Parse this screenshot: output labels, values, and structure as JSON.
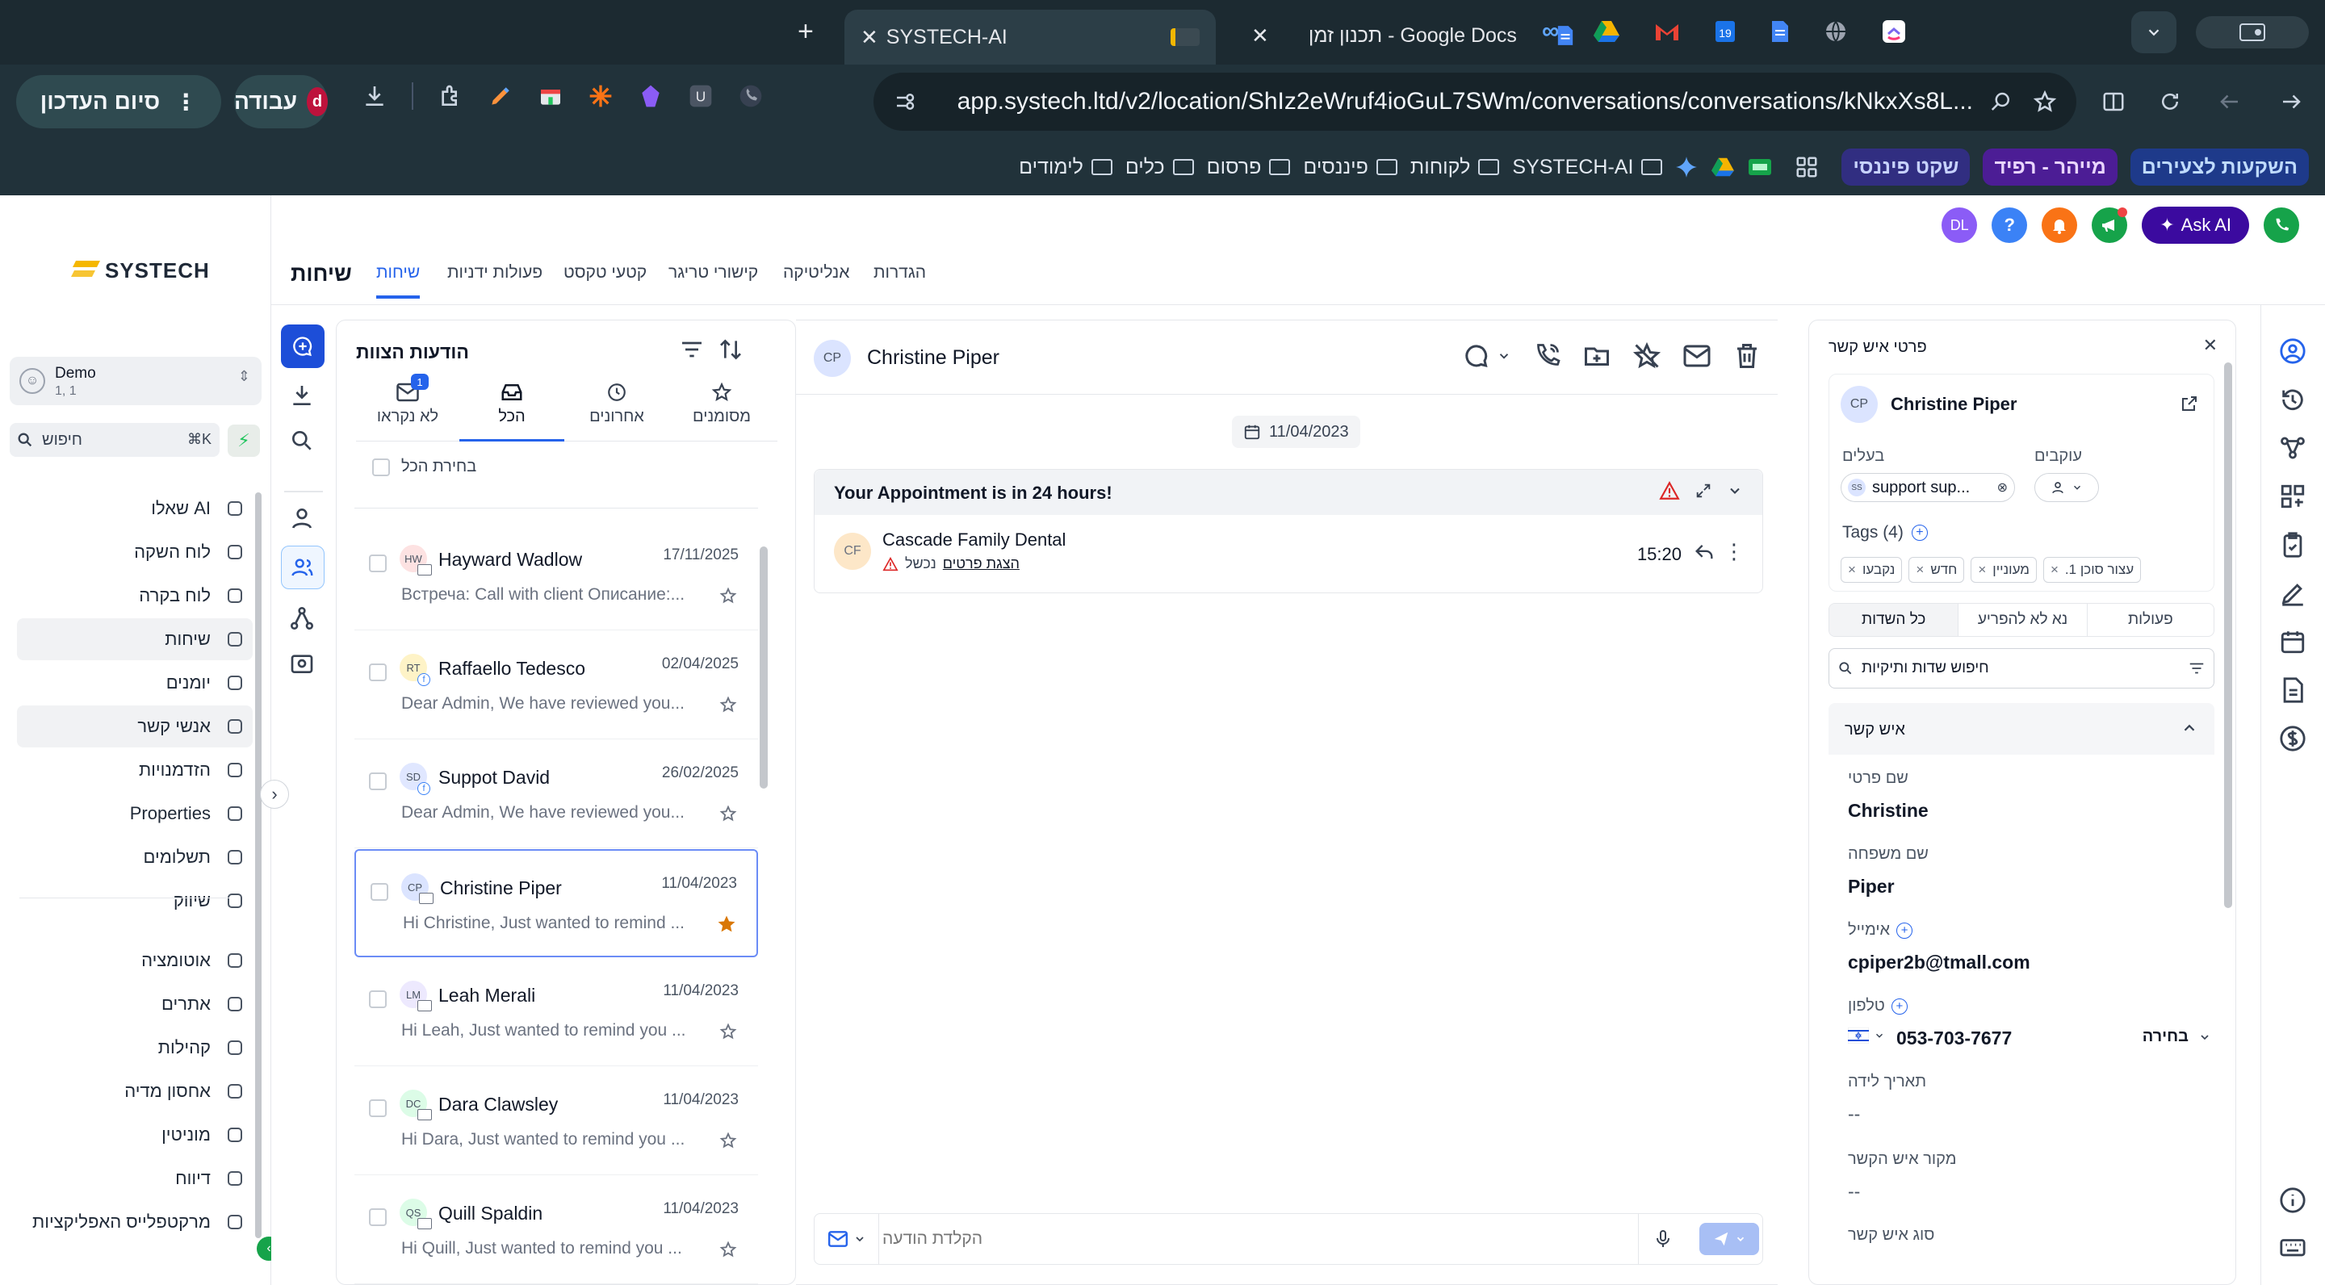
{
  "browser": {
    "tabs": [
      {
        "label": "SYSTECH-AI"
      },
      {
        "label": "תכנון זמן - Google Docs"
      }
    ],
    "url": "app.systech.ltd/v2/location/ShIz2eWruf4ioGuL7SWm/conversations/conversations/kNkxXs8L...",
    "profile_label": "עבודה",
    "profile_initial": "d",
    "update_label": "סיום העדכון",
    "bookmarks": [
      "השקעות לצעירים",
      "מייהר - רפיד",
      "שקט פיננסי",
      "SYSTECH-AI",
      "לקוחות",
      "פיננסים",
      "פרסום",
      "כלים",
      "לימודים"
    ]
  },
  "colors": {
    "accent": "#2563eb",
    "brand_yellow": "#f5b700",
    "active_border": "#6b8cf6",
    "star": "#d97706"
  },
  "app": {
    "logo_text": "SYSTECH",
    "ask_ai": "Ask AI",
    "user_initials": "DL",
    "account": {
      "name": "Demo",
      "sub": "1, 1"
    },
    "search": {
      "placeholder": "חיפוש",
      "shortcut": "⌘K"
    },
    "nav": [
      {
        "label": "שאלו AI",
        "icon": "sparkle-icon"
      },
      {
        "label": "לוח השקה",
        "icon": "launch-icon"
      },
      {
        "label": "לוח בקרה",
        "icon": "dashboard-icon"
      },
      {
        "label": "שיחות",
        "icon": "chat-icon"
      },
      {
        "label": "יומנים",
        "icon": "calendar-icon"
      },
      {
        "label": "אנשי קשר",
        "icon": "contacts-icon"
      },
      {
        "label": "הזדמנויות",
        "icon": "opportunities-icon"
      },
      {
        "label": "Properties",
        "icon": "home-icon"
      },
      {
        "label": "תשלומים",
        "icon": "payments-icon"
      },
      {
        "label": "שיווק",
        "icon": "send-icon"
      },
      {
        "label": "אוטומציה",
        "icon": "automation-icon"
      },
      {
        "label": "אתרים",
        "icon": "sites-icon"
      },
      {
        "label": "קהילות",
        "icon": "badge-icon"
      },
      {
        "label": "אחסון מדיה",
        "icon": "image-icon"
      },
      {
        "label": "מוניטין",
        "icon": "star-icon"
      },
      {
        "label": "דיווח",
        "icon": "report-icon"
      },
      {
        "label": "מרקטפלייס האפליקציות",
        "icon": "apps-icon"
      }
    ],
    "page_title": "שיחות",
    "header_tabs": [
      "שיחות",
      "פעולות ידניות",
      "קטעי טקסט",
      "קישורי טריגר",
      "אנליטיקה",
      "הגדרות"
    ]
  },
  "convlist": {
    "title": "הודעות הצוות",
    "tabs": [
      {
        "label": "לא נקראו",
        "badge": "1"
      },
      {
        "label": "הכל"
      },
      {
        "label": "אחרונים"
      },
      {
        "label": "מסומנים"
      }
    ],
    "select_all": "בחירת הכל",
    "rows": [
      {
        "initials": "HW",
        "name": "Hayward Wadlow",
        "date": "17/11/2025",
        "preview": "Встреча: Call with client Описание:...",
        "av_bg": "#fde2e2",
        "channel": "mail",
        "starred": false
      },
      {
        "initials": "RT",
        "name": "Raffaello Tedesco",
        "date": "02/04/2025",
        "preview": "Dear Admin, We have reviewed you...",
        "av_bg": "#fef3c7",
        "channel": "fb",
        "starred": false
      },
      {
        "initials": "SD",
        "name": "Suppot David",
        "date": "26/02/2025",
        "preview": "Dear Admin, We have reviewed you...",
        "av_bg": "#e0e7ff",
        "channel": "fb",
        "starred": false
      },
      {
        "initials": "CP",
        "name": "Christine Piper",
        "date": "11/04/2023",
        "preview": "Hi Christine, Just wanted to remind ...",
        "av_bg": "#dbe4ff",
        "channel": "mail",
        "starred": true
      },
      {
        "initials": "LM",
        "name": "Leah Merali",
        "date": "11/04/2023",
        "preview": "Hi Leah, Just wanted to remind you ...",
        "av_bg": "#ede9fe",
        "channel": "mail",
        "starred": false
      },
      {
        "initials": "DC",
        "name": "Dara Clawsley",
        "date": "11/04/2023",
        "preview": "Hi Dara, Just wanted to remind you ...",
        "av_bg": "#dcfce7",
        "channel": "mail",
        "starred": false
      },
      {
        "initials": "QS",
        "name": "Quill Spaldin",
        "date": "11/04/2023",
        "preview": "Hi Quill, Just wanted to remind you ...",
        "av_bg": "#dcfce7",
        "channel": "mail",
        "starred": false
      }
    ]
  },
  "chat": {
    "contact_name": "Christine Piper",
    "contact_initials": "CP",
    "date_chip": "11/04/2023",
    "appointment_banner": "Your Appointment is in 24 hours!",
    "message": {
      "sender": "Cascade Family Dental",
      "initials": "CF",
      "status": "נכשל",
      "details_link": "הצגת פרטים",
      "time": "15:20"
    },
    "composer_placeholder": "הקלדת הודעה"
  },
  "details": {
    "title": "פרטי איש קשר",
    "contact_name": "Christine Piper",
    "contact_initials": "CP",
    "owner_label": "בעלים",
    "owner_value": "support sup...",
    "owner_initials": "SS",
    "followers_label": "עוקבים",
    "tags_label": "Tags (4)",
    "tags": [
      "עצור סוכן 1.",
      "מעוניין",
      "חדש",
      "נקבעו"
    ],
    "tabs": [
      "פעולות",
      "נא לא להפריע",
      "כל השדות"
    ],
    "search_placeholder": "חיפוש שדות ותיקיות",
    "section_title": "איש קשר",
    "fields": [
      {
        "label": "שם פרטי",
        "value": "Christine"
      },
      {
        "label": "שם משפחה",
        "value": "Piper"
      },
      {
        "label": "אימייל",
        "value": "cpiper2b@tmall.com"
      },
      {
        "label": "טלפון",
        "value": "053-703-7677"
      },
      {
        "label": "תאריך לידה",
        "value": "--"
      },
      {
        "label": "מקור איש הקשר",
        "value": "--"
      },
      {
        "label": "סוג איש קשר",
        "value": ""
      }
    ],
    "phone_select": "בחירה"
  }
}
